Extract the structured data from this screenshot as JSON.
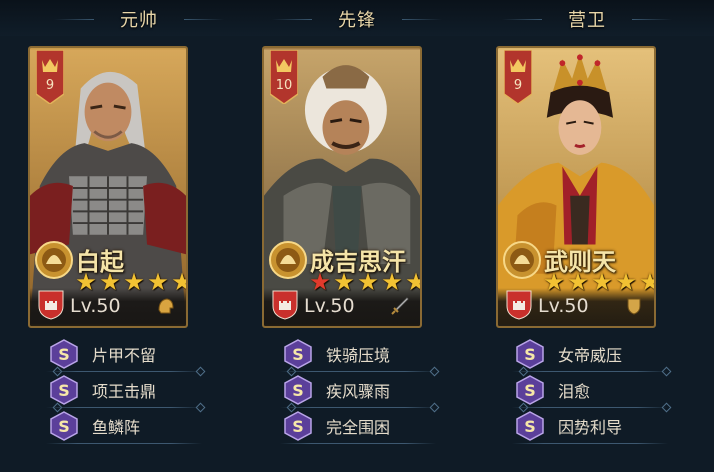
{
  "slots": [
    {
      "header": "元帅",
      "hero": {
        "name": "白起",
        "rank": "9",
        "level": "Lv.50",
        "stars": {
          "total": 5,
          "red": 0
        },
        "equip_icon": "helmet-icon"
      },
      "skills": [
        {
          "grade": "S",
          "name": "片甲不留"
        },
        {
          "grade": "S",
          "name": "项王击鼎"
        },
        {
          "grade": "S",
          "name": "鱼鳞阵"
        }
      ]
    },
    {
      "header": "先锋",
      "hero": {
        "name": "成吉思汗",
        "rank": "10",
        "level": "Lv.50",
        "stars": {
          "total": 5,
          "red": 1
        },
        "equip_icon": "sword-icon"
      },
      "skills": [
        {
          "grade": "S",
          "name": "铁骑压境"
        },
        {
          "grade": "S",
          "name": "疾风骤雨"
        },
        {
          "grade": "S",
          "name": "完全围困"
        }
      ]
    },
    {
      "header": "营卫",
      "hero": {
        "name": "武则天",
        "rank": "9",
        "level": "Lv.50",
        "stars": {
          "total": 5,
          "red": 0
        },
        "equip_icon": "shield-icon"
      },
      "skills": [
        {
          "grade": "S",
          "name": "女帝威压"
        },
        {
          "grade": "S",
          "name": "泪愈"
        },
        {
          "grade": "S",
          "name": "因势利导"
        }
      ]
    }
  ],
  "colors": {
    "background": "#0f1b26",
    "card_border": "#8a6a33",
    "gold_star": "#f2c233",
    "red_star": "#e23a2c",
    "rank_badge": "#b2352c",
    "skill_badge": "#5b3f9a"
  }
}
